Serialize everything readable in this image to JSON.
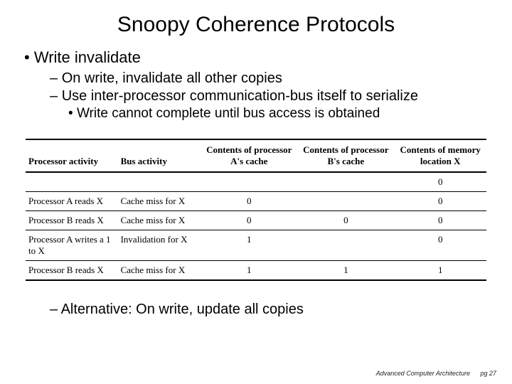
{
  "title": "Snoopy Coherence Protocols",
  "bullets": {
    "l1": "Write invalidate",
    "l2a": "On write, invalidate all other copies",
    "l2b": "Use inter-processor communication-bus itself to serialize",
    "l3": "Write cannot complete until bus access is obtained",
    "l2c": "Alternative: On write, update all copies"
  },
  "table": {
    "headers": {
      "h1": "Processor activity",
      "h2": "Bus activity",
      "h3": "Contents of processor A's cache",
      "h4": "Contents of processor B's cache",
      "h5": "Contents of memory location X"
    },
    "rows": [
      {
        "activity": "",
        "bus": "",
        "a": "",
        "b": "",
        "mem": "0"
      },
      {
        "activity": "Processor A reads X",
        "bus": "Cache miss for X",
        "a": "0",
        "b": "",
        "mem": "0"
      },
      {
        "activity": "Processor B reads X",
        "bus": "Cache miss for X",
        "a": "0",
        "b": "0",
        "mem": "0"
      },
      {
        "activity": "Processor A writes a 1 to X",
        "bus": "Invalidation for X",
        "a": "1",
        "b": "",
        "mem": "0"
      },
      {
        "activity": "Processor B reads X",
        "bus": "Cache miss for X",
        "a": "1",
        "b": "1",
        "mem": "1"
      }
    ]
  },
  "footer": {
    "course": "Advanced Computer Architecture",
    "page": "pg 27"
  }
}
